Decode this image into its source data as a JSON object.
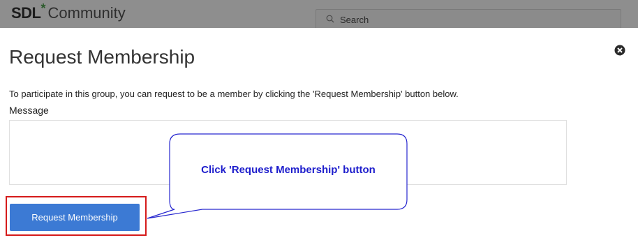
{
  "header": {
    "logo_brand": "SDL",
    "logo_star": "*",
    "logo_word": "Community",
    "search_placeholder": "Search"
  },
  "modal": {
    "title": "Request Membership",
    "instructions": "To participate in this group, you can request to be a member by clicking the 'Request Membership' button below.",
    "message_label": "Message",
    "message_value": "",
    "request_button_label": "Request Membership"
  },
  "annotation": {
    "callout_text": "Click 'Request Membership' button",
    "callout_text_color": "#1d1dcc",
    "highlight_color": "#d51a1a"
  },
  "colors": {
    "primary_button": "#3c7ad4",
    "overlay_header": "#8e8e8e"
  }
}
